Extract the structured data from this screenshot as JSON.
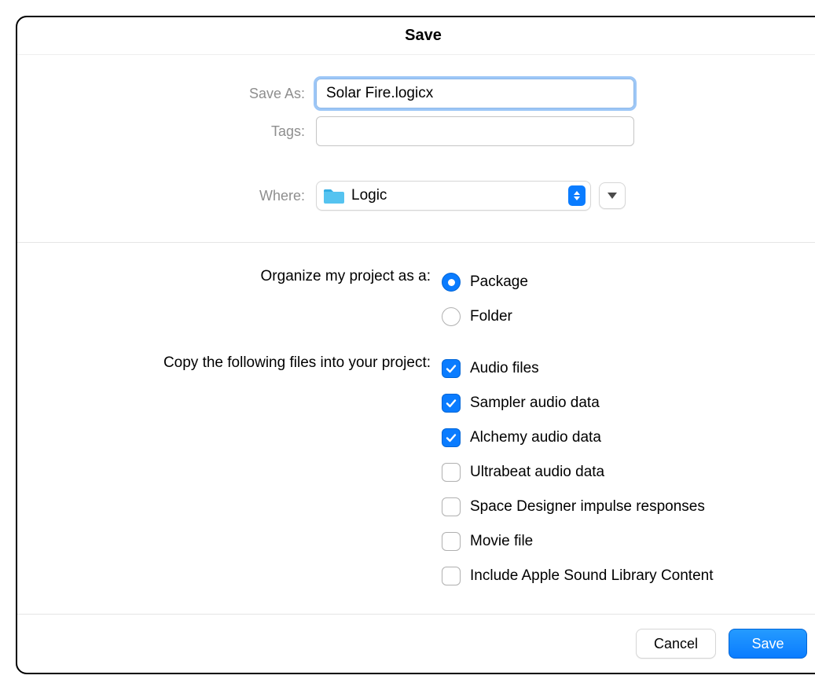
{
  "title": "Save",
  "fields": {
    "save_as_label": "Save As:",
    "save_as_value": "Solar Fire.logicx",
    "tags_label": "Tags:",
    "tags_value": "",
    "where_label": "Where:",
    "where_value": "Logic"
  },
  "organize": {
    "label": "Organize my project as a:",
    "options": [
      {
        "label": "Package",
        "checked": true
      },
      {
        "label": "Folder",
        "checked": false
      }
    ]
  },
  "copy": {
    "label": "Copy the following files into your project:",
    "options": [
      {
        "label": "Audio files",
        "checked": true
      },
      {
        "label": "Sampler audio data",
        "checked": true
      },
      {
        "label": "Alchemy audio data",
        "checked": true
      },
      {
        "label": "Ultrabeat audio data",
        "checked": false
      },
      {
        "label": "Space Designer impulse responses",
        "checked": false
      },
      {
        "label": "Movie file",
        "checked": false
      },
      {
        "label": "Include Apple Sound Library Content",
        "checked": false
      }
    ]
  },
  "buttons": {
    "cancel": "Cancel",
    "save": "Save"
  }
}
